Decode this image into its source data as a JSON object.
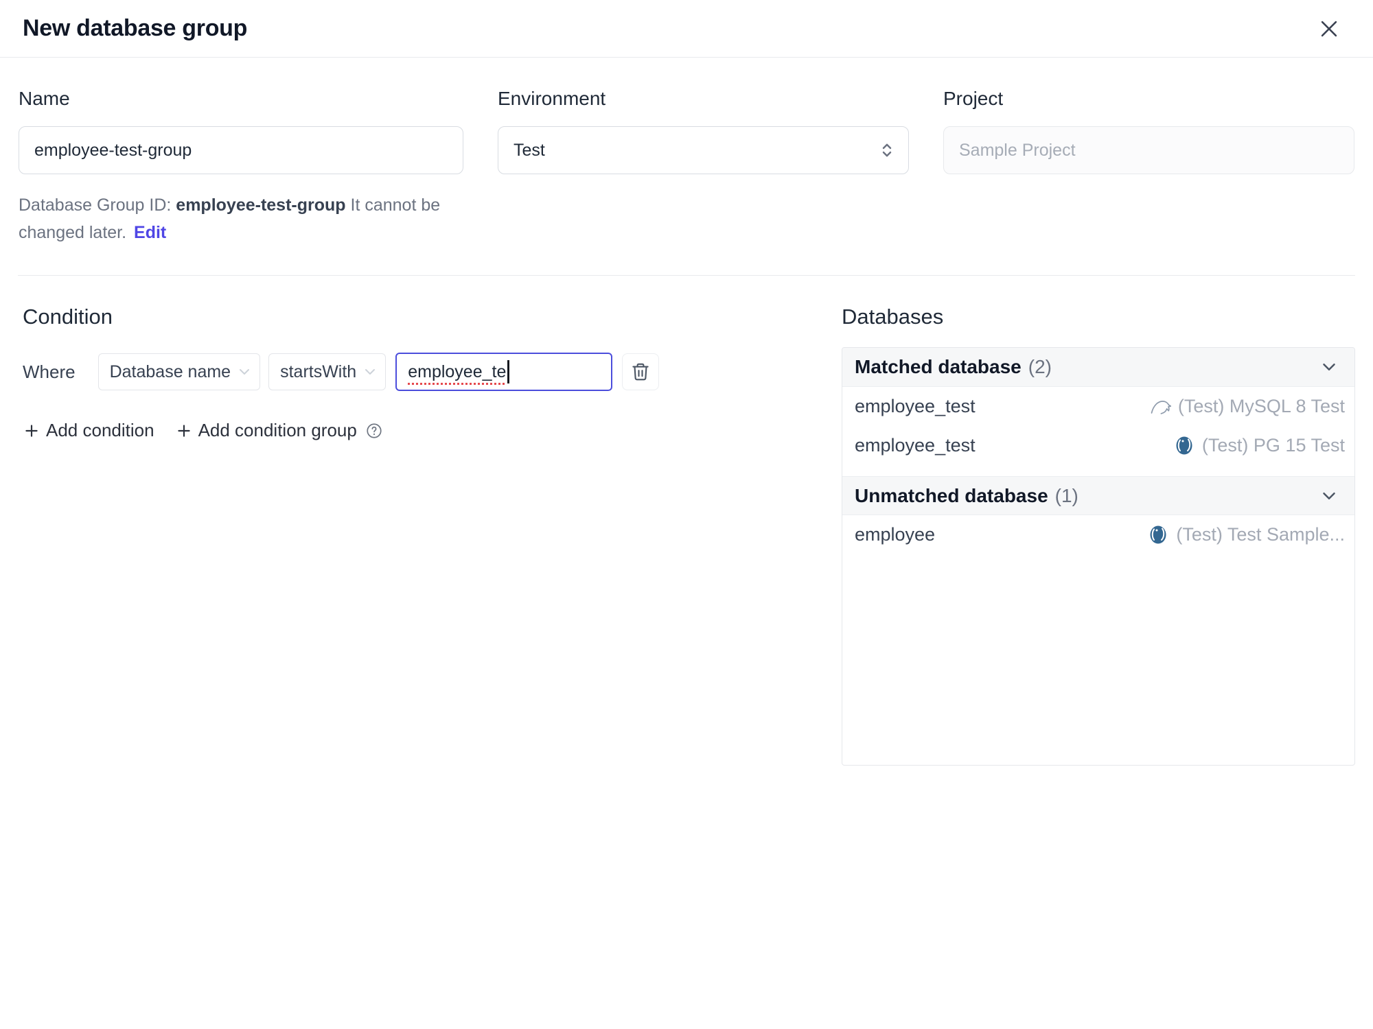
{
  "dialog": {
    "title": "New database group"
  },
  "form": {
    "name": {
      "label": "Name",
      "value": "employee-test-group"
    },
    "environment": {
      "label": "Environment",
      "value": "Test"
    },
    "project": {
      "label": "Project",
      "value": "Sample Project"
    },
    "group_id_note": {
      "prefix": "Database Group ID: ",
      "id": "employee-test-group",
      "suffix": " It cannot be changed later.",
      "edit_label": "Edit"
    }
  },
  "condition": {
    "heading": "Condition",
    "where_label": "Where",
    "field_select": "Database name",
    "operator_select": "startsWith",
    "value_input": "employee_te",
    "add_condition_label": "Add condition",
    "add_condition_group_label": "Add condition group"
  },
  "databases": {
    "heading": "Databases",
    "matched": {
      "title": "Matched database",
      "count": "(2)",
      "rows": [
        {
          "name": "employee_test",
          "engine": "mysql",
          "instance": "(Test) MySQL 8 Test"
        },
        {
          "name": "employee_test",
          "engine": "postgres",
          "instance": "(Test) PG 15 Test"
        }
      ]
    },
    "unmatched": {
      "title": "Unmatched database",
      "count": "(1)",
      "rows": [
        {
          "name": "employee",
          "engine": "postgres",
          "instance": "(Test) Test Sample..."
        }
      ]
    }
  }
}
